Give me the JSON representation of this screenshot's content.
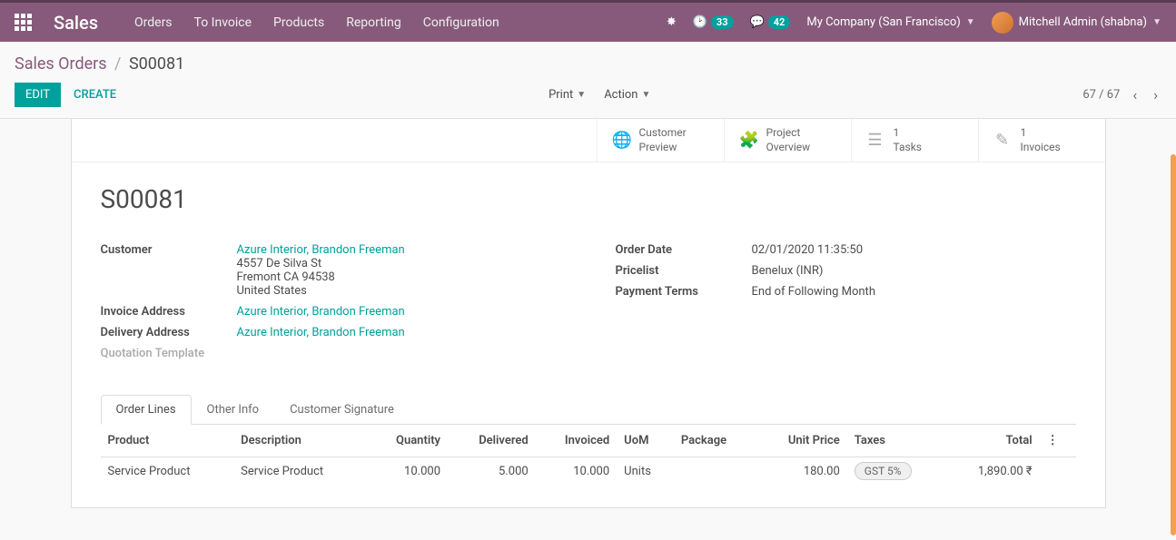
{
  "topbar": {
    "brand": "Sales",
    "menu": [
      "Orders",
      "To Invoice",
      "Products",
      "Reporting",
      "Configuration"
    ],
    "activities_count": "33",
    "messages_count": "42",
    "company": "My Company (San Francisco)",
    "user": "Mitchell Admin (shabna)"
  },
  "breadcrumb": {
    "root": "Sales Orders",
    "current": "S00081"
  },
  "controls": {
    "edit": "EDIT",
    "create": "CREATE",
    "print": "Print",
    "action": "Action",
    "pager": "67 / 67"
  },
  "stat_buttons": [
    {
      "line1": "Customer",
      "line2": "Preview"
    },
    {
      "line1": "Project",
      "line2": "Overview"
    },
    {
      "line1": "1",
      "line2": "Tasks"
    },
    {
      "line1": "1",
      "line2": "Invoices"
    }
  ],
  "order": {
    "name": "S00081",
    "customer_label": "Customer",
    "customer_link": "Azure Interior, Brandon Freeman",
    "addr1": "4557 De Silva St",
    "addr2": "Fremont CA 94538",
    "addr3": "United States",
    "invoice_address_label": "Invoice Address",
    "invoice_address": "Azure Interior, Brandon Freeman",
    "delivery_address_label": "Delivery Address",
    "delivery_address": "Azure Interior, Brandon Freeman",
    "quotation_template_label": "Quotation Template",
    "order_date_label": "Order Date",
    "order_date": "02/01/2020 11:35:50",
    "pricelist_label": "Pricelist",
    "pricelist": "Benelux (INR)",
    "payment_terms_label": "Payment Terms",
    "payment_terms": "End of Following Month"
  },
  "tabs": [
    "Order Lines",
    "Other Info",
    "Customer Signature"
  ],
  "table": {
    "headers": [
      "Product",
      "Description",
      "Quantity",
      "Delivered",
      "Invoiced",
      "UoM",
      "Package",
      "Unit Price",
      "Taxes",
      "Total"
    ],
    "row": {
      "product": "Service Product",
      "description": "Service Product",
      "quantity": "10.000",
      "delivered": "5.000",
      "invoiced": "10.000",
      "uom": "Units",
      "package": "",
      "unit_price": "180.00",
      "taxes": "GST 5%",
      "total": "1,890.00 ₹"
    }
  }
}
